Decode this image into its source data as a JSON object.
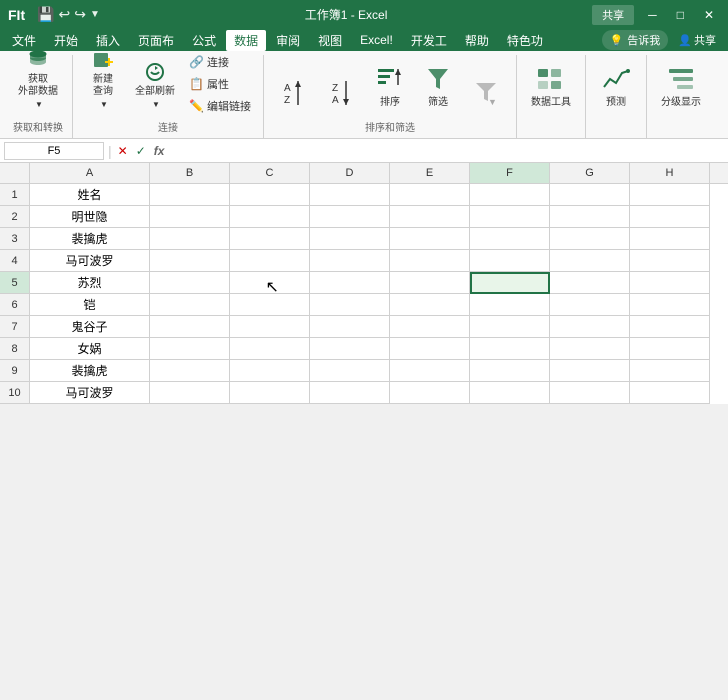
{
  "titleBar": {
    "appName": "FIt",
    "fileName": "工作簿1 - Excel",
    "buttons": [
      "minimize",
      "maximize",
      "close"
    ],
    "rightButtons": [
      "共享"
    ]
  },
  "menuBar": {
    "items": [
      "文件",
      "开始",
      "插入",
      "页面布",
      "公式",
      "数据",
      "审阅",
      "视图",
      "Excel!",
      "开发工",
      "帮助",
      "特色功"
    ],
    "activeItem": "数据",
    "notifyIcon": "告诉我",
    "shareLabel": "共享"
  },
  "ribbon": {
    "groups": [
      {
        "id": "get-external",
        "label": "获取和转换",
        "buttons": [
          {
            "id": "get-external-data",
            "label": "获取\n外部数据",
            "hasDropdown": true
          }
        ]
      },
      {
        "id": "connections",
        "label": "连接",
        "buttons": [
          {
            "id": "new-query",
            "label": "新建\n查询",
            "hasDropdown": true
          },
          {
            "id": "refresh-all",
            "label": "全部刷新",
            "hasDropdown": true
          }
        ],
        "smallButtons": [
          {
            "id": "connections-btn",
            "label": "连接"
          },
          {
            "id": "properties-btn",
            "label": "属性"
          },
          {
            "id": "edit-links-btn",
            "label": "编辑链接"
          }
        ]
      },
      {
        "id": "sort-filter",
        "label": "排序和筛选",
        "buttons": [
          {
            "id": "sort-az",
            "label": ""
          },
          {
            "id": "sort-za",
            "label": ""
          },
          {
            "id": "sort",
            "label": "排序"
          },
          {
            "id": "filter",
            "label": "筛选"
          },
          {
            "id": "advanced",
            "label": ""
          }
        ]
      },
      {
        "id": "data-tools",
        "label": "",
        "buttons": [
          {
            "id": "data-tools-btn",
            "label": "数据工具"
          }
        ]
      },
      {
        "id": "forecast",
        "label": "",
        "buttons": [
          {
            "id": "forecast-btn",
            "label": "预测"
          }
        ]
      },
      {
        "id": "outline",
        "label": "",
        "buttons": [
          {
            "id": "outline-btn",
            "label": "分级显示"
          }
        ]
      }
    ]
  },
  "formulaBar": {
    "nameBox": "F5",
    "cancelLabel": "✕",
    "confirmLabel": "✓",
    "functionLabel": "fx",
    "formula": ""
  },
  "spreadsheet": {
    "columns": [
      "A",
      "B",
      "C",
      "D",
      "E",
      "F",
      "G",
      "H"
    ],
    "selectedCell": "F5",
    "rows": [
      {
        "rowNum": 1,
        "cells": [
          "姓名",
          "",
          "",
          "",
          "",
          "",
          "",
          ""
        ]
      },
      {
        "rowNum": 2,
        "cells": [
          "明世隐",
          "",
          "",
          "",
          "",
          "",
          "",
          ""
        ]
      },
      {
        "rowNum": 3,
        "cells": [
          "裴擒虎",
          "",
          "",
          "",
          "",
          "",
          "",
          ""
        ]
      },
      {
        "rowNum": 4,
        "cells": [
          "马可波罗",
          "",
          "",
          "",
          "",
          "",
          "",
          ""
        ]
      },
      {
        "rowNum": 5,
        "cells": [
          "苏烈",
          "",
          "",
          "",
          "",
          "",
          "",
          ""
        ]
      },
      {
        "rowNum": 6,
        "cells": [
          "铠",
          "",
          "",
          "",
          "",
          "",
          "",
          ""
        ]
      },
      {
        "rowNum": 7,
        "cells": [
          "鬼谷子",
          "",
          "",
          "",
          "",
          "",
          "",
          ""
        ]
      },
      {
        "rowNum": 8,
        "cells": [
          "女娲",
          "",
          "",
          "",
          "",
          "",
          "",
          ""
        ]
      },
      {
        "rowNum": 9,
        "cells": [
          "裴擒虎",
          "",
          "",
          "",
          "",
          "",
          "",
          ""
        ]
      },
      {
        "rowNum": 10,
        "cells": [
          "马可波罗",
          "",
          "",
          "",
          "",
          "",
          "",
          ""
        ]
      }
    ]
  },
  "icons": {
    "database": "🗄",
    "lightning": "⚡",
    "table": "📊",
    "refresh": "🔄",
    "sortAZ": "↑",
    "sortZA": "↓",
    "filter": "▼",
    "tools": "🔧",
    "forecast": "📈",
    "outline": "≡"
  }
}
